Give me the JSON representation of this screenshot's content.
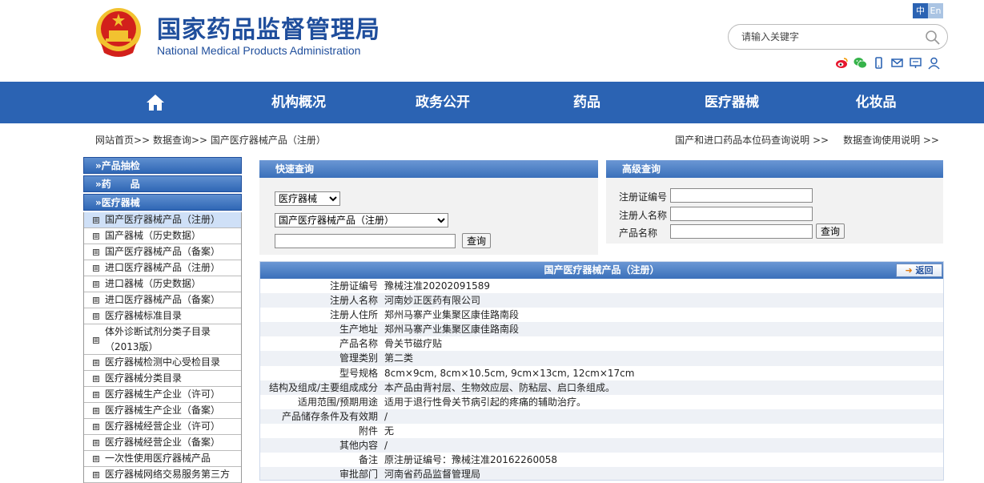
{
  "header": {
    "title": "国家药品监督管理局",
    "subtitle": "National Medical Products Administration",
    "lang": {
      "zh": "中",
      "en": "En"
    },
    "search_placeholder": "请输入关键字"
  },
  "nav": {
    "items": [
      "机构概况",
      "政务公开",
      "药品",
      "医疗器械",
      "化妆品"
    ]
  },
  "breadcrumb": {
    "home": "网站首页",
    "sep": ">>",
    "query": "数据查询",
    "current": "国产医疗器械产品（注册）"
  },
  "toplinks": {
    "link1": "国产和进口药品本位码查询说明 >>",
    "link2": "数据查询使用说明 >>"
  },
  "sidebar": {
    "categories": [
      "»产品抽检",
      "»药　　品",
      "»医疗器械"
    ],
    "items": [
      "国产医疗器械产品（注册）",
      "国产器械（历史数据）",
      "国产医疗器械产品（备案）",
      "进口医疗器械产品（注册）",
      "进口器械（历史数据）",
      "进口医疗器械产品（备案）",
      "医疗器械标准目录",
      "体外诊断试剂分类子目录（2013版）",
      "医疗器械检测中心受检目录",
      "医疗器械分类目录",
      "医疗器械生产企业（许可）",
      "医疗器械生产企业（备案）",
      "医疗器械经营企业（许可）",
      "医疗器械经营企业（备案）",
      "一次性使用医疗器械产品",
      "医疗器械网络交易服务第三方"
    ],
    "box_glyph": "⊞"
  },
  "quick": {
    "title": "快速查询",
    "select1": "医疗器械",
    "select2": "国产医疗器械产品（注册）",
    "button": "查询"
  },
  "advanced": {
    "title": "高级查询",
    "labels": [
      "注册证编号",
      "注册人名称",
      "产品名称"
    ],
    "button": "查询"
  },
  "detail": {
    "title": "国产医疗器械产品（注册）",
    "back": "返回",
    "rows": [
      {
        "k": "注册证编号",
        "v": "豫械注准20202091589"
      },
      {
        "k": "注册人名称",
        "v": "河南妙正医药有限公司"
      },
      {
        "k": "注册人住所",
        "v": "郑州马寨产业集聚区康佳路南段"
      },
      {
        "k": "生产地址",
        "v": "郑州马寨产业集聚区康佳路南段"
      },
      {
        "k": "产品名称",
        "v": "骨关节磁疗贴"
      },
      {
        "k": "管理类别",
        "v": "第二类"
      },
      {
        "k": "型号规格",
        "v": "8cm×9cm, 8cm×10.5cm, 9cm×13cm, 12cm×17cm"
      },
      {
        "k": "结构及组成/主要组成成分",
        "v": "本产品由背衬层、生物效应层、防粘层、启口条组成。"
      },
      {
        "k": "适用范围/预期用途",
        "v": "适用于退行性骨关节病引起的疼痛的辅助治疗。"
      },
      {
        "k": "产品储存条件及有效期",
        "v": "/"
      },
      {
        "k": "附件",
        "v": "无"
      },
      {
        "k": "其他内容",
        "v": "/"
      },
      {
        "k": "备注",
        "v": "原注册证编号：豫械注准20162260058"
      },
      {
        "k": "审批部门",
        "v": "河南省药品监督管理局"
      }
    ]
  },
  "colors": {
    "brand_blue": "#2b63b3",
    "title_blue": "#1f4e9c",
    "emblem_red": "#d2201b",
    "emblem_gold": "#f2c230"
  }
}
